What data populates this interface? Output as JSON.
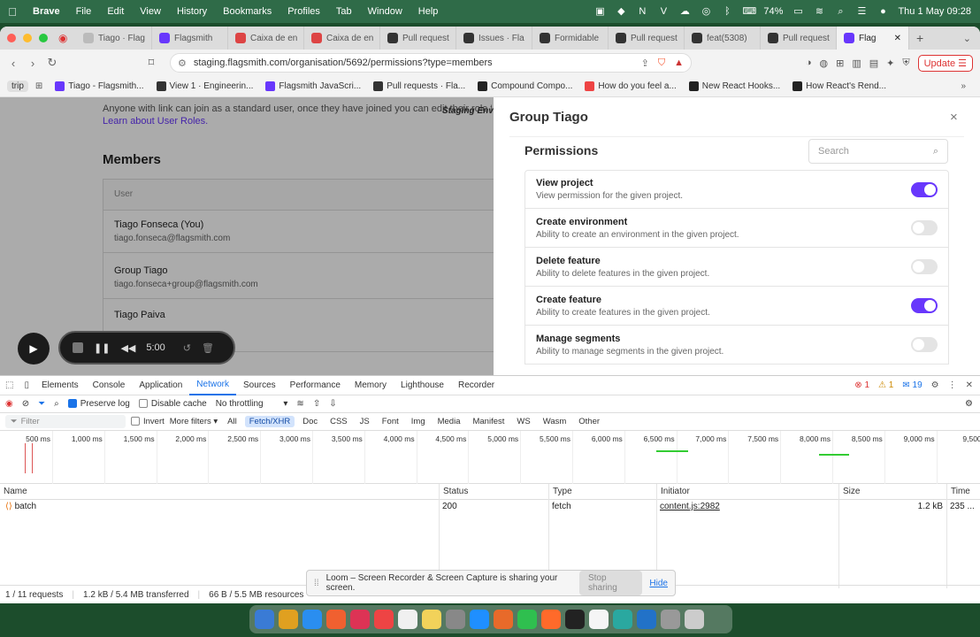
{
  "menubar": {
    "app": "Brave",
    "items": [
      "File",
      "Edit",
      "View",
      "History",
      "Bookmarks",
      "Profiles",
      "Tab",
      "Window",
      "Help"
    ],
    "battery": "74%",
    "datetime": "Thu 1 May  09:28"
  },
  "tabs": [
    {
      "label": "Tiago · Flag",
      "color": "#bbb"
    },
    {
      "label": "Flagsmith",
      "color": "#6837fc"
    },
    {
      "label": "Caixa de en",
      "color": "#d44"
    },
    {
      "label": "Caixa de en",
      "color": "#d44"
    },
    {
      "label": "Pull request",
      "color": "#333"
    },
    {
      "label": "Issues · Fla",
      "color": "#333"
    },
    {
      "label": "Formidable",
      "color": "#333"
    },
    {
      "label": "Pull request",
      "color": "#333"
    },
    {
      "label": "feat(5308)",
      "color": "#333"
    },
    {
      "label": "Pull request",
      "color": "#333"
    },
    {
      "label": "Flag",
      "color": "#6837fc"
    }
  ],
  "address": {
    "url": "staging.flagsmith.com/organisation/5692/permissions?type=members"
  },
  "toolbar": {
    "update_label": "Update"
  },
  "bookmarks": {
    "trip": "trip",
    "items": [
      {
        "label": "Tiago - Flagsmith...",
        "color": "#6837fc"
      },
      {
        "label": "View 1 · Engineerin...",
        "color": "#333"
      },
      {
        "label": "Flagsmith JavaScri...",
        "color": "#6837fc"
      },
      {
        "label": "Pull requests · Fla...",
        "color": "#333"
      },
      {
        "label": "Compound Compo...",
        "color": "#222"
      },
      {
        "label": "How do you feel a...",
        "color": "#e44"
      },
      {
        "label": "New React Hooks...",
        "color": "#222"
      },
      {
        "label": "How React's Rend...",
        "color": "#222"
      }
    ]
  },
  "page": {
    "intro": "Anyone with link can join as a standard user, once they have joined you can edit their role fro",
    "env_badge": "Staging Env",
    "learn_link": "Learn about User Roles.",
    "members_title": "Members",
    "table_header": "User",
    "members": [
      {
        "name": "Tiago Fonseca (You)",
        "email": "tiago.fonseca@flagsmith.com"
      },
      {
        "name": "Group Tiago",
        "email": "tiago.fonseca+group@flagsmith.com"
      },
      {
        "name": "Tiago Paiva",
        "email": ""
      }
    ]
  },
  "panel": {
    "title": "Group Tiago",
    "close": "×",
    "permissions_title": "Permissions",
    "search_placeholder": "Search",
    "permissions": [
      {
        "name": "View project",
        "desc": "View permission for the given project.",
        "enabled": true
      },
      {
        "name": "Create environment",
        "desc": "Ability to create an environment in the given project.",
        "enabled": false
      },
      {
        "name": "Delete feature",
        "desc": "Ability to delete features in the given project.",
        "enabled": false
      },
      {
        "name": "Create feature",
        "desc": "Ability to create features in the given project.",
        "enabled": true
      },
      {
        "name": "Manage segments",
        "desc": "Ability to manage segments in the given project.",
        "enabled": false
      }
    ]
  },
  "loom": {
    "time": "5:00"
  },
  "devtools": {
    "tabs": [
      "Elements",
      "Console",
      "Application",
      "Network",
      "Sources",
      "Performance",
      "Memory",
      "Lighthouse",
      "Recorder"
    ],
    "active_tab": "Network",
    "errors": "1",
    "warnings": "1",
    "infos": "19",
    "preserve_log": "Preserve log",
    "disable_cache": "Disable cache",
    "throttling": "No throttling",
    "filter_placeholder": "Filter",
    "invert": "Invert",
    "more_filters": "More filters",
    "filter_types": [
      "All",
      "Fetch/XHR",
      "Doc",
      "CSS",
      "JS",
      "Font",
      "Img",
      "Media",
      "Manifest",
      "WS",
      "Wasm",
      "Other"
    ],
    "active_filter": "Fetch/XHR",
    "timeline_ticks": [
      "500 ms",
      "1,000 ms",
      "1,500 ms",
      "2,000 ms",
      "2,500 ms",
      "3,000 ms",
      "3,500 ms",
      "4,000 ms",
      "4,500 ms",
      "5,000 ms",
      "5,500 ms",
      "6,000 ms",
      "6,500 ms",
      "7,000 ms",
      "7,500 ms",
      "8,000 ms",
      "8,500 ms",
      "9,000 ms",
      "9,500"
    ],
    "columns": [
      "Name",
      "Status",
      "Type",
      "Initiator",
      "Size",
      "Time"
    ],
    "rows": [
      {
        "name": "batch",
        "status": "200",
        "type": "fetch",
        "initiator": "content.js:2982",
        "size": "1.2 kB",
        "time": "235 ..."
      }
    ],
    "status": {
      "requests": "1 / 11 requests",
      "transferred": "1.2 kB / 5.4 MB transferred",
      "resources": "66 B / 5.5 MB resources"
    }
  },
  "loomshare": {
    "message": "Loom – Screen Recorder & Screen Capture is sharing your screen.",
    "stop": "Stop sharing",
    "hide": "Hide"
  },
  "dock": {
    "colors": [
      "#3a7bd5",
      "#e0a020",
      "#2a8ef0",
      "#f06030",
      "#dd3355",
      "#ee4444",
      "#f0f0f0",
      "#f2d25a",
      "#888888",
      "#1f8fff",
      "#e86a2a",
      "#2fbf4f",
      "#ff6a2a",
      "#222222",
      "#f5f5f5",
      "#2aa8a0",
      "#2272c8",
      "#999999",
      "#cccccc"
    ]
  }
}
